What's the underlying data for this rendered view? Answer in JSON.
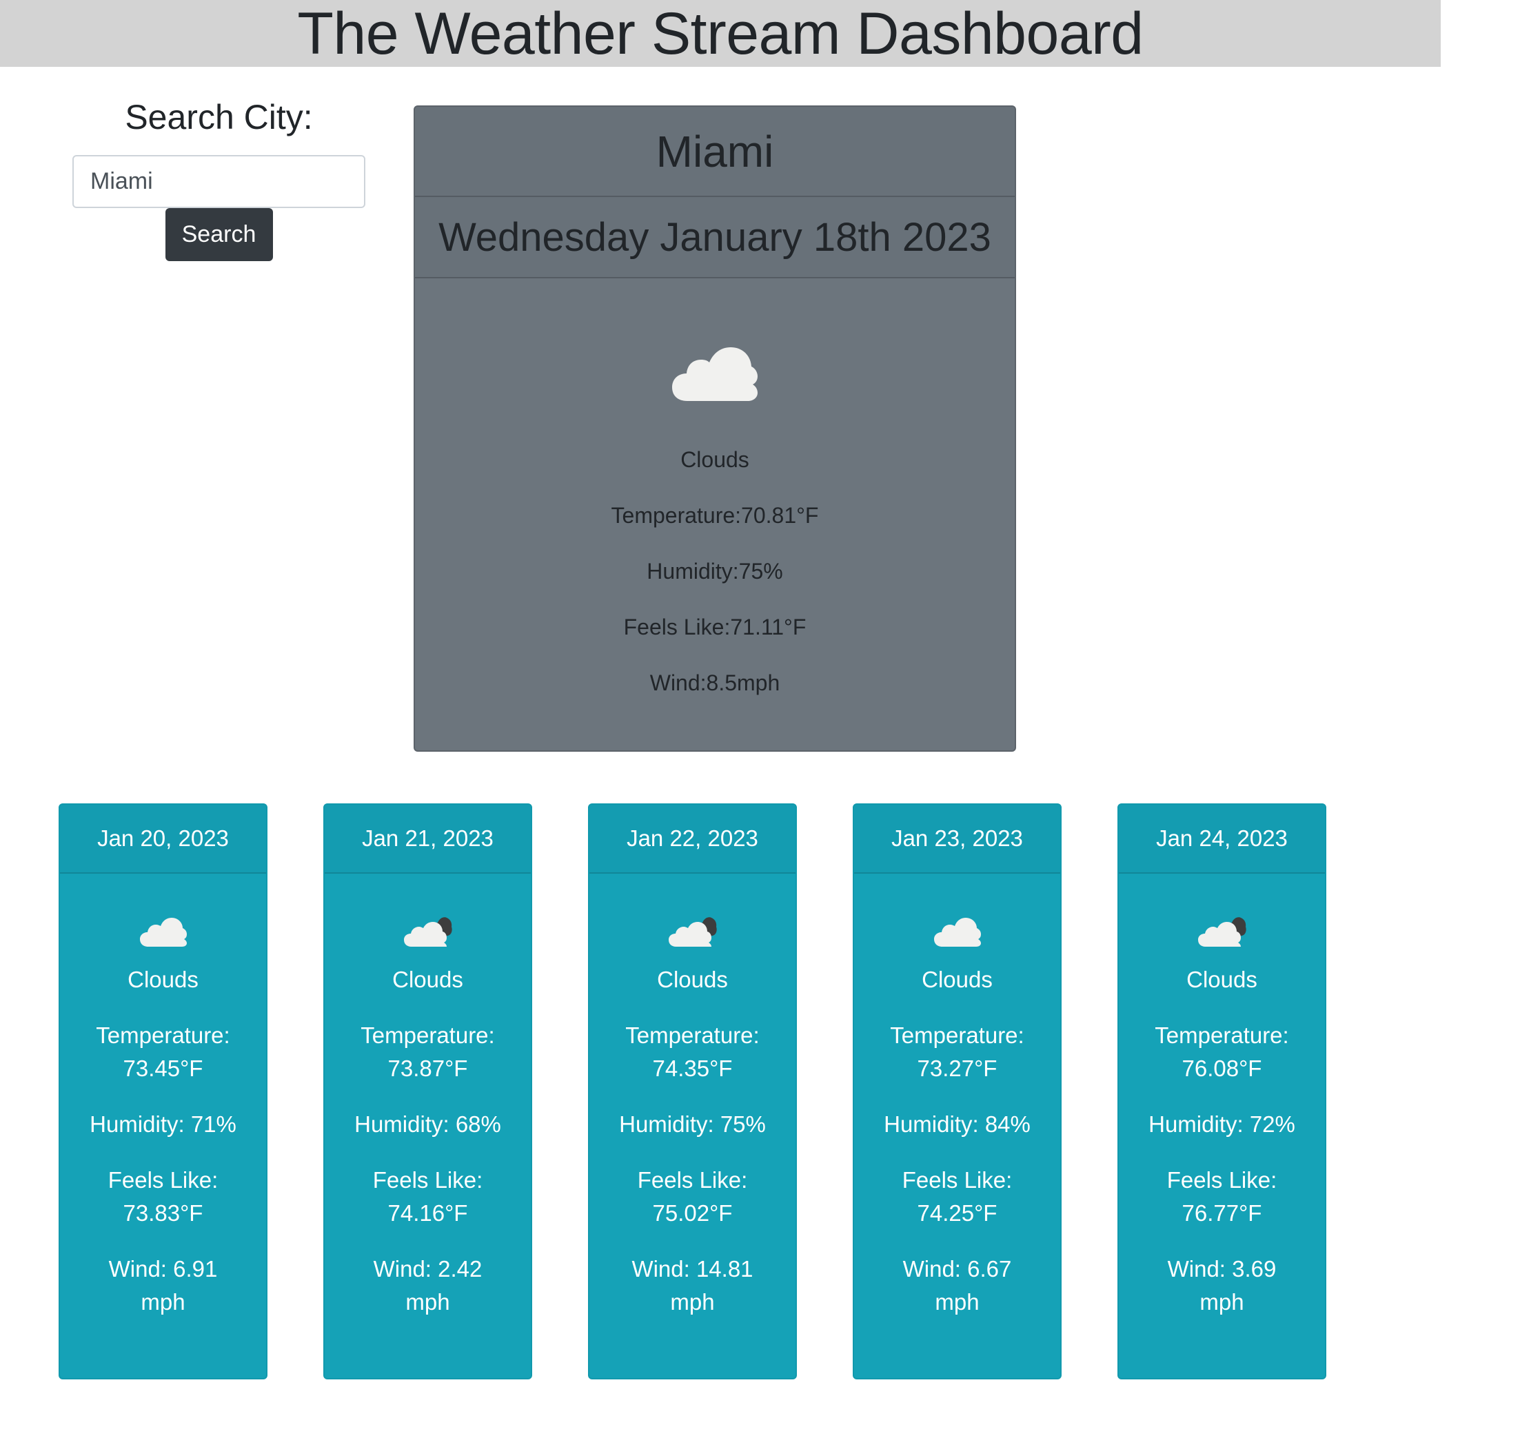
{
  "header": {
    "title": "The Weather Stream Dashboard"
  },
  "search": {
    "label": "Search City:",
    "value": "Miami",
    "button_label": "Search"
  },
  "current": {
    "city": "Miami",
    "date": "Wednesday January 18th 2023",
    "icon": "cloud-icon",
    "description": "Clouds",
    "temperature": "Temperature:70.81°F",
    "humidity": "Humidity:75%",
    "feels_like": "Feels Like:71.11°F",
    "wind": "Wind:8.5mph"
  },
  "forecast": [
    {
      "date": "Jan 20, 2023",
      "icon": "cloud-icon",
      "description": "Clouds",
      "temperature_label": "Temperature:",
      "temperature": "73.45°F",
      "humidity": "Humidity: 71%",
      "feels_like_label": "Feels Like:",
      "feels_like": "73.83°F",
      "wind_label": "Wind: 6.91",
      "wind_unit": "mph"
    },
    {
      "date": "Jan 21, 2023",
      "icon": "broken-clouds-icon",
      "description": "Clouds",
      "temperature_label": "Temperature:",
      "temperature": "73.87°F",
      "humidity": "Humidity: 68%",
      "feels_like_label": "Feels Like:",
      "feels_like": "74.16°F",
      "wind_label": "Wind: 2.42",
      "wind_unit": "mph"
    },
    {
      "date": "Jan 22, 2023",
      "icon": "broken-clouds-icon",
      "description": "Clouds",
      "temperature_label": "Temperature:",
      "temperature": "74.35°F",
      "humidity": "Humidity: 75%",
      "feels_like_label": "Feels Like:",
      "feels_like": "75.02°F",
      "wind_label": "Wind: 14.81",
      "wind_unit": "mph"
    },
    {
      "date": "Jan 23, 2023",
      "icon": "cloud-icon",
      "description": "Clouds",
      "temperature_label": "Temperature:",
      "temperature": "73.27°F",
      "humidity": "Humidity: 84%",
      "feels_like_label": "Feels Like:",
      "feels_like": "74.25°F",
      "wind_label": "Wind: 6.67",
      "wind_unit": "mph"
    },
    {
      "date": "Jan 24, 2023",
      "icon": "broken-clouds-icon",
      "description": "Clouds",
      "temperature_label": "Temperature:",
      "temperature": "76.08°F",
      "humidity": "Humidity: 72%",
      "feels_like_label": "Feels Like:",
      "feels_like": "76.77°F",
      "wind_label": "Wind: 3.69",
      "wind_unit": "mph"
    }
  ],
  "colors": {
    "header_bg": "#d3d3d3",
    "current_card_bg": "#6c757d",
    "forecast_card_bg": "#15a2b7",
    "button_bg": "#343a40",
    "cloud_light": "#f1f1ef",
    "cloud_dark": "#3d3d3d"
  }
}
